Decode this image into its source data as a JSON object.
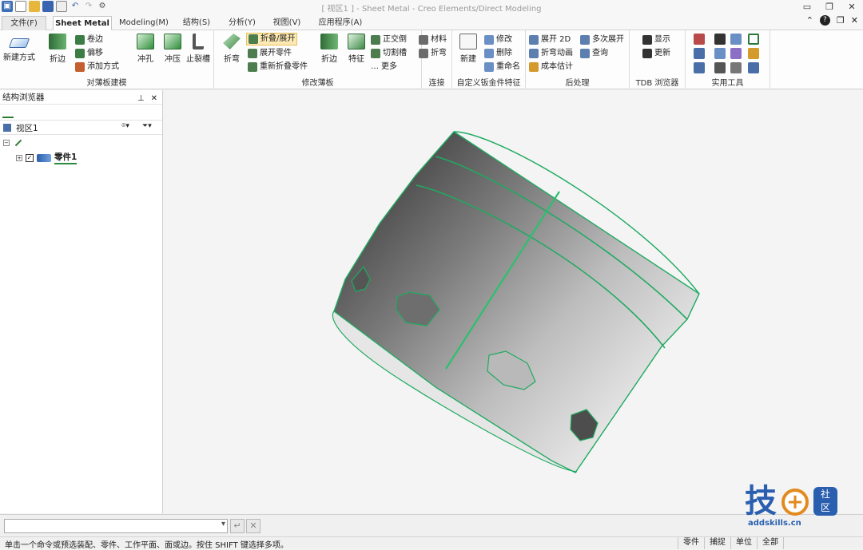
{
  "window": {
    "title": "[ 视区1 ] - Sheet Metal - Creo Elements/Direct Modeling",
    "controls": [
      "▭",
      "❐",
      "✕"
    ]
  },
  "quick_access": [
    "app-icon",
    "new-icon",
    "open-icon",
    "save-icon",
    "print-icon",
    "undo-icon",
    "redo-icon",
    "gear-icon"
  ],
  "tabs": [
    {
      "label": "文件(F)",
      "active": false
    },
    {
      "label": "Sheet Metal",
      "active": true
    },
    {
      "label": "Modeling(M)",
      "active": false
    },
    {
      "label": "结构(S)",
      "active": false
    },
    {
      "label": "分析(Y)",
      "active": false
    },
    {
      "label": "视图(V)",
      "active": false
    },
    {
      "label": "应用程序(A)",
      "active": false
    }
  ],
  "help": {
    "minimize": "⌃",
    "help": "?",
    "restore": "❐",
    "close": "✕"
  },
  "ribbon": {
    "groups": [
      {
        "label": "对薄板建模",
        "buttons": {
          "new": "新建方式",
          "flange": "折边",
          "roll": "卷边",
          "offset": "偏移",
          "add_relief": "添加方式",
          "punch": "冲孔",
          "stamp": "冲压",
          "relief": "止裂槽"
        }
      },
      {
        "label": "修改薄板",
        "buttons": {
          "bend": "折弯",
          "fold_unfold": "折叠/展开",
          "unfold_part": "展开零件",
          "refold": "重新折叠零件",
          "flange2": "折边",
          "feature": "特征",
          "mitre": "正交倒",
          "cut_groove": "切割槽",
          "more": "更多"
        }
      },
      {
        "label": "连接",
        "buttons": {
          "material": "材料",
          "bend2": "折弯"
        }
      },
      {
        "label": "自定义钣金件特征",
        "buttons": {
          "new": "新建",
          "modify": "修改",
          "delete": "删除",
          "rename": "重命名"
        }
      },
      {
        "label": "后处理",
        "buttons": {
          "unfold2d": "展开 2D",
          "bend_anim": "折弯动画",
          "cost": "成本估计",
          "multi_unfold": "多次展开",
          "query": "查询"
        }
      },
      {
        "label": "TDB 浏览器",
        "buttons": {
          "show": "显示",
          "update": "更新"
        }
      },
      {
        "label": "实用工具"
      }
    ]
  },
  "browser": {
    "title": "结构浏览器",
    "pin": "⊥",
    "close": "✕",
    "view_label": "视区1",
    "part_name": "零件1",
    "checkbox_checked": true
  },
  "command": {
    "input_value": "",
    "confirm": "↵",
    "cancel": "✕"
  },
  "status": {
    "text": "单击一个命令或预选装配、零件、工作平面、面或边。按住 SHIFT 键选择多项。",
    "filter_part": "零件",
    "snap": "捕捉",
    "unit": "单位",
    "all": "全部"
  },
  "watermark": {
    "brand": "技",
    "community": "社区",
    "url": "addskills.cn"
  },
  "colors": {
    "accent": "#2b8a3e",
    "edge": "#1faa60",
    "cylinder_dark": "#4a4a4a",
    "cylinder_light": "#cfcfcf"
  }
}
